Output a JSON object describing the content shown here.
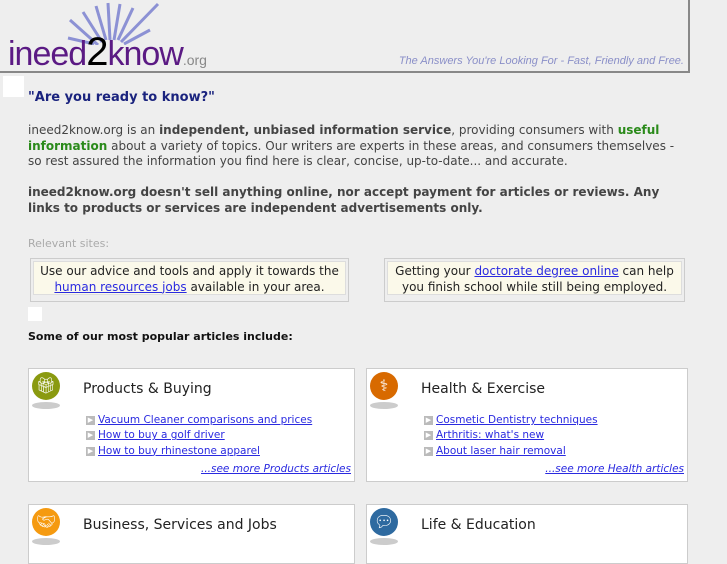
{
  "header": {
    "logo_main": "ineed",
    "logo_two": "2",
    "logo_know": "know",
    "logo_org": ".org",
    "tagline": "The Answers You're Looking For - Fast, Friendly and Free."
  },
  "intro": {
    "heading": "\"Are you ready to know?\"",
    "p1_a": "ineed2know.org is an ",
    "p1_b": "independent, unbiased information service",
    "p1_c": ", providing consumers with ",
    "p1_d": "useful information",
    "p1_e": " about a variety of topics. Our writers are experts in these areas, and consumers themselves - so rest assured the information you find here is clear, concise, up-to-date... and accurate.",
    "p2": "ineed2know.org doesn't sell anything online, nor accept payment for articles or reviews. Any links to products or services are independent advertisements only."
  },
  "relevant": {
    "label": "Relevant sites:",
    "ad1_a": "Use our advice and tools and apply it towards the ",
    "ad1_link": "human resources jobs",
    "ad1_b": " available in your area.",
    "ad2_a": "Getting your ",
    "ad2_link": "doctorate degree online",
    "ad2_b": " can help you finish school while still being employed."
  },
  "popular_heading": "Some of our most popular articles include:",
  "cards": [
    {
      "title": "Products & Buying",
      "icon": "gift-icon",
      "color": "#8a9a10",
      "links": [
        "Vacuum Cleaner comparisons and prices",
        "How to buy a golf driver",
        "How to buy rhinestone apparel"
      ],
      "more": "...see more Products articles"
    },
    {
      "title": "Health & Exercise",
      "icon": "caduceus-icon",
      "color": "#d86a00",
      "links": [
        "Cosmetic Dentistry techniques",
        "Arthritis: what's new",
        "About laser hair removal"
      ],
      "more": "...see more Health articles"
    },
    {
      "title": "Business, Services and Jobs",
      "icon": "handshake-icon",
      "color": "#f59a10"
    },
    {
      "title": "Life & Education",
      "icon": "speech-bubbles-icon",
      "color": "#2e6aa0"
    }
  ]
}
